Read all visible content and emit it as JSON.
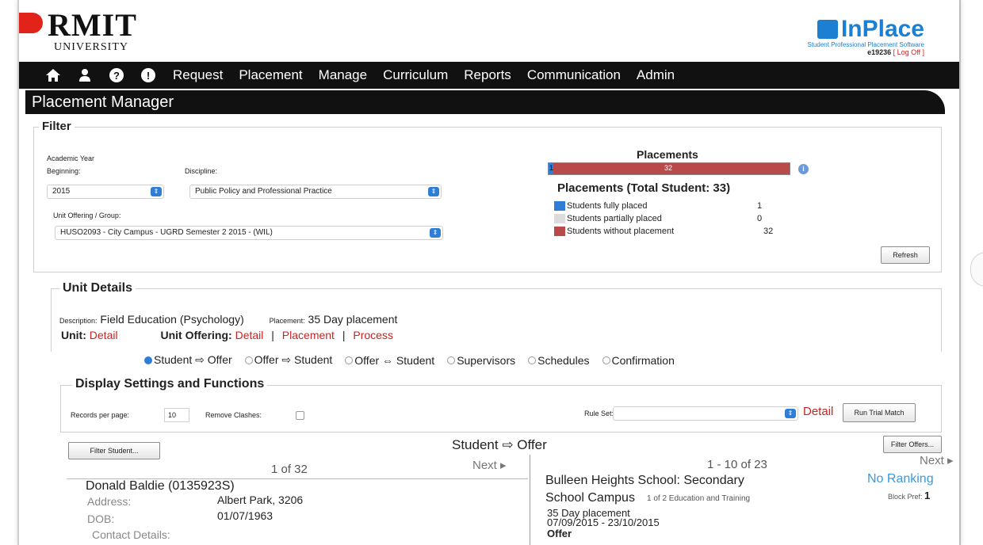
{
  "header": {
    "university_name": "RMIT",
    "university_sub": "UNIVERSITY",
    "product_name": "InPlace",
    "product_tagline": "Student Professional Placement Software",
    "user_id": "e19236",
    "logoff_label": "[ Log Off ]"
  },
  "nav": {
    "icons": [
      "home-icon",
      "user-icon",
      "help-icon",
      "alert-icon"
    ],
    "items": [
      "Request",
      "Placement",
      "Manage",
      "Curriculum",
      "Reports",
      "Communication",
      "Admin"
    ]
  },
  "page_title": "Placement Manager",
  "filter": {
    "legend": "Filter",
    "academic_year_label": "Academic Year",
    "beginning_label": "Beginning:",
    "beginning_value": "2015",
    "discipline_label": "Discipline:",
    "discipline_value": "Public Policy and Professional Practice",
    "unit_offering_label": "Unit Offering / Group:",
    "unit_offering_value": "HUSO2093 - City Campus - UGRD Semester 2 2015 - (WIL)",
    "refresh_label": "Refresh"
  },
  "placements": {
    "title": "Placements",
    "bar_blue_value": "1",
    "bar_red_value": "32",
    "subtitle": "Placements (Total Student: 33)",
    "legend": [
      {
        "label": "Students fully placed",
        "value": "1",
        "color": "#2e7dd7"
      },
      {
        "label": "Students partially placed",
        "value": "0",
        "color": "#dcdcdc"
      },
      {
        "label": "Students without placement",
        "value": "32",
        "color": "#b94a4a"
      }
    ]
  },
  "unit_details": {
    "legend": "Unit Details",
    "description_label": "Description:",
    "description_value": "Field Education (Psychology)",
    "placement_label": "Placement:",
    "placement_value": "35 Day placement",
    "unit_label": "Unit:",
    "unit_link": "Detail",
    "offering_label": "Unit Offering:",
    "offering_links": [
      "Detail",
      "Placement",
      "Process"
    ],
    "separator": "|"
  },
  "modes": [
    "Student ⇨ Offer",
    "Offer ⇨ Student",
    "Offer ⇔ Student",
    "Supervisors",
    "Schedules",
    "Confirmation"
  ],
  "display": {
    "legend": "Display Settings and Functions",
    "records_label": "Records per page:",
    "records_value": "10",
    "remove_clashes_label": "Remove Clashes:",
    "ruleset_label": "Rule Set:",
    "detail_link": "Detail",
    "run_trial_label": "Run Trial Match"
  },
  "match": {
    "title": "Student ⇨ Offer",
    "filter_student_label": "Filter Student...",
    "filter_offers_label": "Filter Offers...",
    "student_pager": "1 of 32",
    "offer_pager": "1 - 10 of 23",
    "next_label": "Next ▸"
  },
  "student": {
    "name": "Donald Baldie (0135923S)",
    "address_label": "Address:",
    "address_value": "Albert Park, 3206",
    "dob_label": "DOB:",
    "dob_value": "01/07/1963",
    "contact_label": "Contact Details:"
  },
  "offer": {
    "name_line1": "Bulleen Heights School: Secondary",
    "name_line2": "School Campus",
    "count_text": "1 of 2 Education and Training",
    "ranking": "No Ranking",
    "block_pref_label": "Block Pref:",
    "block_pref_value": "1",
    "duration": "35  Day placement",
    "dates": "07/09/2015  -  23/10/2015",
    "type": "Offer"
  }
}
